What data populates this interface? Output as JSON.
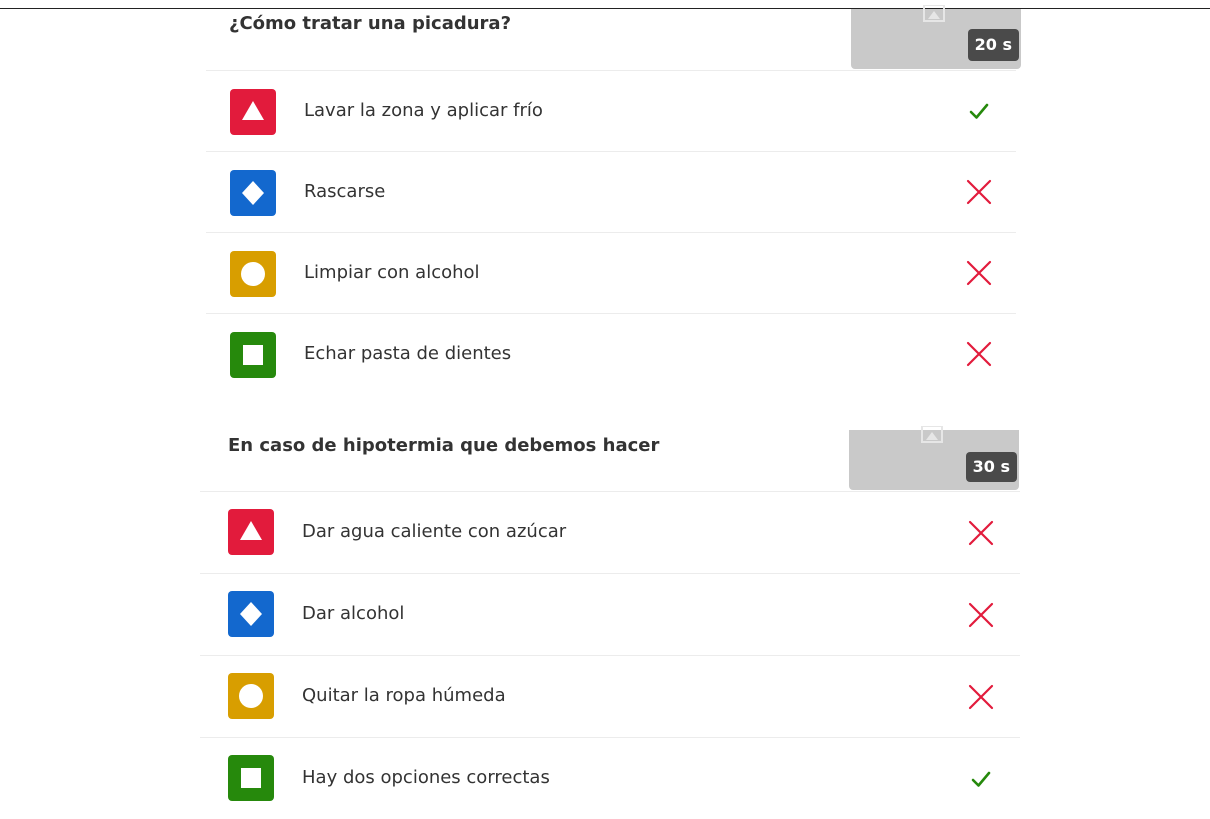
{
  "colors": {
    "red": "#e21b3c",
    "blue": "#1368ce",
    "yellow": "#d89e00",
    "green": "#26890c",
    "correct": "#26890c",
    "incorrect": "#e21b3c"
  },
  "questions": [
    {
      "title": "¿Cómo tratar una picadura?",
      "time_limit": "20 s",
      "thumbnail_icon": "image-placeholder-icon",
      "answers": [
        {
          "shape": "triangle-icon",
          "text": "Lavar la zona y aplicar frío",
          "result": "correct"
        },
        {
          "shape": "diamond-icon",
          "text": "Rascarse",
          "result": "incorrect"
        },
        {
          "shape": "circle-icon",
          "text": "Limpiar con alcohol",
          "result": "incorrect"
        },
        {
          "shape": "square-icon",
          "text": "Echar pasta de dientes",
          "result": "incorrect"
        }
      ]
    },
    {
      "title": "En caso de hipotermia que debemos hacer",
      "time_limit": "30 s",
      "thumbnail_icon": "image-placeholder-icon",
      "answers": [
        {
          "shape": "triangle-icon",
          "text": "Dar agua caliente con azúcar",
          "result": "incorrect"
        },
        {
          "shape": "diamond-icon",
          "text": "Dar alcohol",
          "result": "incorrect"
        },
        {
          "shape": "circle-icon",
          "text": "Quitar la ropa húmeda",
          "result": "incorrect"
        },
        {
          "shape": "square-icon",
          "text": "Hay dos opciones correctas",
          "result": "correct"
        }
      ]
    }
  ]
}
